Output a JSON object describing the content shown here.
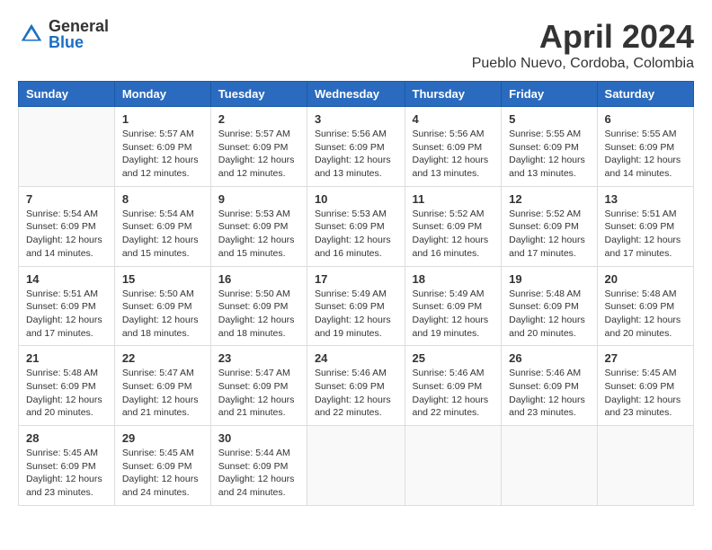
{
  "header": {
    "logo_general": "General",
    "logo_blue": "Blue",
    "title": "April 2024",
    "location": "Pueblo Nuevo, Cordoba, Colombia"
  },
  "calendar": {
    "weekdays": [
      "Sunday",
      "Monday",
      "Tuesday",
      "Wednesday",
      "Thursday",
      "Friday",
      "Saturday"
    ],
    "weeks": [
      [
        {
          "day": "",
          "info": ""
        },
        {
          "day": "1",
          "info": "Sunrise: 5:57 AM\nSunset: 6:09 PM\nDaylight: 12 hours\nand 12 minutes."
        },
        {
          "day": "2",
          "info": "Sunrise: 5:57 AM\nSunset: 6:09 PM\nDaylight: 12 hours\nand 12 minutes."
        },
        {
          "day": "3",
          "info": "Sunrise: 5:56 AM\nSunset: 6:09 PM\nDaylight: 12 hours\nand 13 minutes."
        },
        {
          "day": "4",
          "info": "Sunrise: 5:56 AM\nSunset: 6:09 PM\nDaylight: 12 hours\nand 13 minutes."
        },
        {
          "day": "5",
          "info": "Sunrise: 5:55 AM\nSunset: 6:09 PM\nDaylight: 12 hours\nand 13 minutes."
        },
        {
          "day": "6",
          "info": "Sunrise: 5:55 AM\nSunset: 6:09 PM\nDaylight: 12 hours\nand 14 minutes."
        }
      ],
      [
        {
          "day": "7",
          "info": "Sunrise: 5:54 AM\nSunset: 6:09 PM\nDaylight: 12 hours\nand 14 minutes."
        },
        {
          "day": "8",
          "info": "Sunrise: 5:54 AM\nSunset: 6:09 PM\nDaylight: 12 hours\nand 15 minutes."
        },
        {
          "day": "9",
          "info": "Sunrise: 5:53 AM\nSunset: 6:09 PM\nDaylight: 12 hours\nand 15 minutes."
        },
        {
          "day": "10",
          "info": "Sunrise: 5:53 AM\nSunset: 6:09 PM\nDaylight: 12 hours\nand 16 minutes."
        },
        {
          "day": "11",
          "info": "Sunrise: 5:52 AM\nSunset: 6:09 PM\nDaylight: 12 hours\nand 16 minutes."
        },
        {
          "day": "12",
          "info": "Sunrise: 5:52 AM\nSunset: 6:09 PM\nDaylight: 12 hours\nand 17 minutes."
        },
        {
          "day": "13",
          "info": "Sunrise: 5:51 AM\nSunset: 6:09 PM\nDaylight: 12 hours\nand 17 minutes."
        }
      ],
      [
        {
          "day": "14",
          "info": "Sunrise: 5:51 AM\nSunset: 6:09 PM\nDaylight: 12 hours\nand 17 minutes."
        },
        {
          "day": "15",
          "info": "Sunrise: 5:50 AM\nSunset: 6:09 PM\nDaylight: 12 hours\nand 18 minutes."
        },
        {
          "day": "16",
          "info": "Sunrise: 5:50 AM\nSunset: 6:09 PM\nDaylight: 12 hours\nand 18 minutes."
        },
        {
          "day": "17",
          "info": "Sunrise: 5:49 AM\nSunset: 6:09 PM\nDaylight: 12 hours\nand 19 minutes."
        },
        {
          "day": "18",
          "info": "Sunrise: 5:49 AM\nSunset: 6:09 PM\nDaylight: 12 hours\nand 19 minutes."
        },
        {
          "day": "19",
          "info": "Sunrise: 5:48 AM\nSunset: 6:09 PM\nDaylight: 12 hours\nand 20 minutes."
        },
        {
          "day": "20",
          "info": "Sunrise: 5:48 AM\nSunset: 6:09 PM\nDaylight: 12 hours\nand 20 minutes."
        }
      ],
      [
        {
          "day": "21",
          "info": "Sunrise: 5:48 AM\nSunset: 6:09 PM\nDaylight: 12 hours\nand 20 minutes."
        },
        {
          "day": "22",
          "info": "Sunrise: 5:47 AM\nSunset: 6:09 PM\nDaylight: 12 hours\nand 21 minutes."
        },
        {
          "day": "23",
          "info": "Sunrise: 5:47 AM\nSunset: 6:09 PM\nDaylight: 12 hours\nand 21 minutes."
        },
        {
          "day": "24",
          "info": "Sunrise: 5:46 AM\nSunset: 6:09 PM\nDaylight: 12 hours\nand 22 minutes."
        },
        {
          "day": "25",
          "info": "Sunrise: 5:46 AM\nSunset: 6:09 PM\nDaylight: 12 hours\nand 22 minutes."
        },
        {
          "day": "26",
          "info": "Sunrise: 5:46 AM\nSunset: 6:09 PM\nDaylight: 12 hours\nand 23 minutes."
        },
        {
          "day": "27",
          "info": "Sunrise: 5:45 AM\nSunset: 6:09 PM\nDaylight: 12 hours\nand 23 minutes."
        }
      ],
      [
        {
          "day": "28",
          "info": "Sunrise: 5:45 AM\nSunset: 6:09 PM\nDaylight: 12 hours\nand 23 minutes."
        },
        {
          "day": "29",
          "info": "Sunrise: 5:45 AM\nSunset: 6:09 PM\nDaylight: 12 hours\nand 24 minutes."
        },
        {
          "day": "30",
          "info": "Sunrise: 5:44 AM\nSunset: 6:09 PM\nDaylight: 12 hours\nand 24 minutes."
        },
        {
          "day": "",
          "info": ""
        },
        {
          "day": "",
          "info": ""
        },
        {
          "day": "",
          "info": ""
        },
        {
          "day": "",
          "info": ""
        }
      ]
    ]
  }
}
